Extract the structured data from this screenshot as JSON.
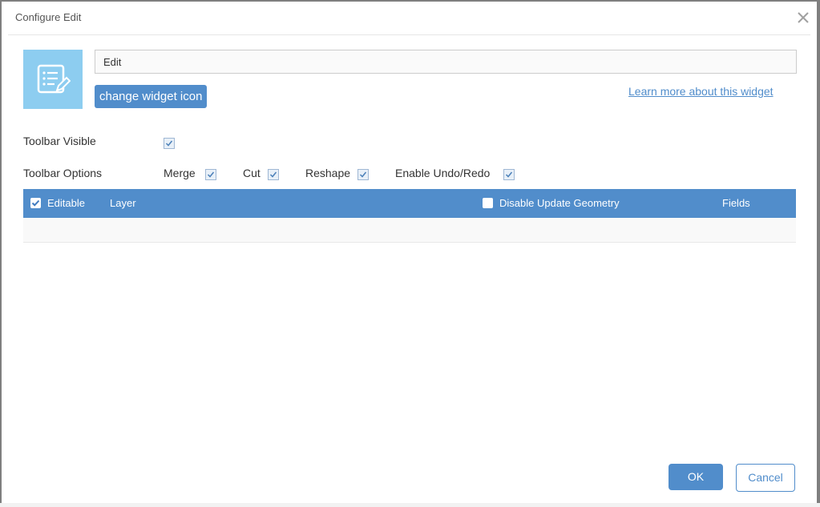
{
  "dialog": {
    "title": "Configure Edit",
    "close_icon": "close-icon"
  },
  "widget": {
    "icon": "edit-widget-icon",
    "name_value": "Edit",
    "change_icon_label": "change widget icon",
    "learn_more_label": "Learn more about this widget"
  },
  "options": {
    "toolbar_visible_label": "Toolbar Visible",
    "toolbar_visible_checked": true,
    "toolbar_options_label": "Toolbar Options",
    "items": [
      {
        "label": "Merge",
        "checked": true
      },
      {
        "label": "Cut",
        "checked": true
      },
      {
        "label": "Reshape",
        "checked": true
      },
      {
        "label": "Enable Undo/Redo",
        "checked": true
      }
    ]
  },
  "table": {
    "columns": {
      "editable": "Editable",
      "layer": "Layer",
      "disable_update_geometry": "Disable Update Geometry",
      "fields": "Fields"
    },
    "editable_checked": true,
    "disable_update_geometry_checked": false,
    "rows": []
  },
  "footer": {
    "ok_label": "OK",
    "cancel_label": "Cancel"
  },
  "colors": {
    "accent": "#518dcb",
    "widget_icon_bg": "#8dcdf0"
  }
}
